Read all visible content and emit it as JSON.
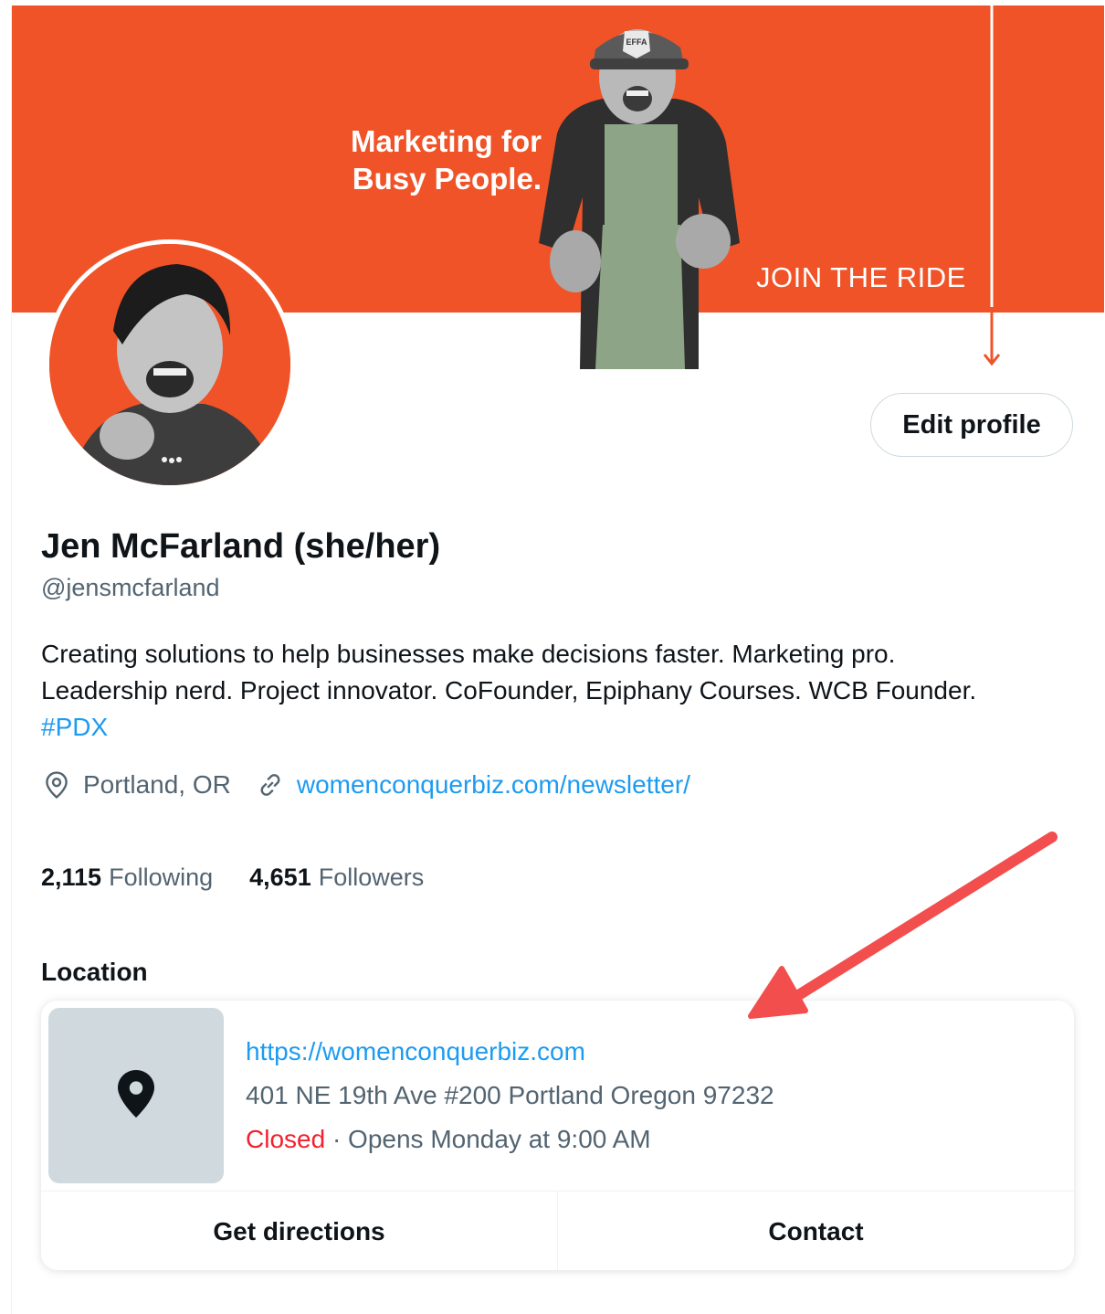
{
  "banner": {
    "headline_line1": "Marketing for",
    "headline_line2": "Busy People.",
    "cta": "JOIN THE RIDE",
    "cap_text": "EFFA",
    "background_color": "#f05328"
  },
  "profile": {
    "edit_button": "Edit profile",
    "name": "Jen McFarland (she/her)",
    "handle": "@jensmcfarland",
    "bio_line1": "Creating solutions to help businesses make decisions faster. Marketing pro.",
    "bio_line2": "Leadership nerd. Project innovator. CoFounder, Epiphany Courses. WCB Founder.",
    "bio_hashtag": "#PDX",
    "location": "Portland, OR",
    "website": "womenconquerbiz.com/newsletter/",
    "location_icon": "location-pin-outline-icon",
    "link_icon": "link-icon"
  },
  "stats": {
    "following_count": "2,115",
    "following_label": "Following",
    "followers_count": "4,651",
    "followers_label": "Followers"
  },
  "location_section": {
    "title": "Location",
    "url": "https://womenconquerbiz.com",
    "address": "401 NE 19th Ave #200 Portland Oregon 97232",
    "status": "Closed",
    "hours": " · Opens Monday at 9:00 AM",
    "map_icon": "map-pin-icon",
    "directions_button": "Get directions",
    "contact_button": "Contact"
  },
  "colors": {
    "accent_link": "#1d9bf0",
    "secondary_text": "#536471",
    "closed_red": "#f4212e",
    "annotation_arrow": "#f24e4e"
  }
}
